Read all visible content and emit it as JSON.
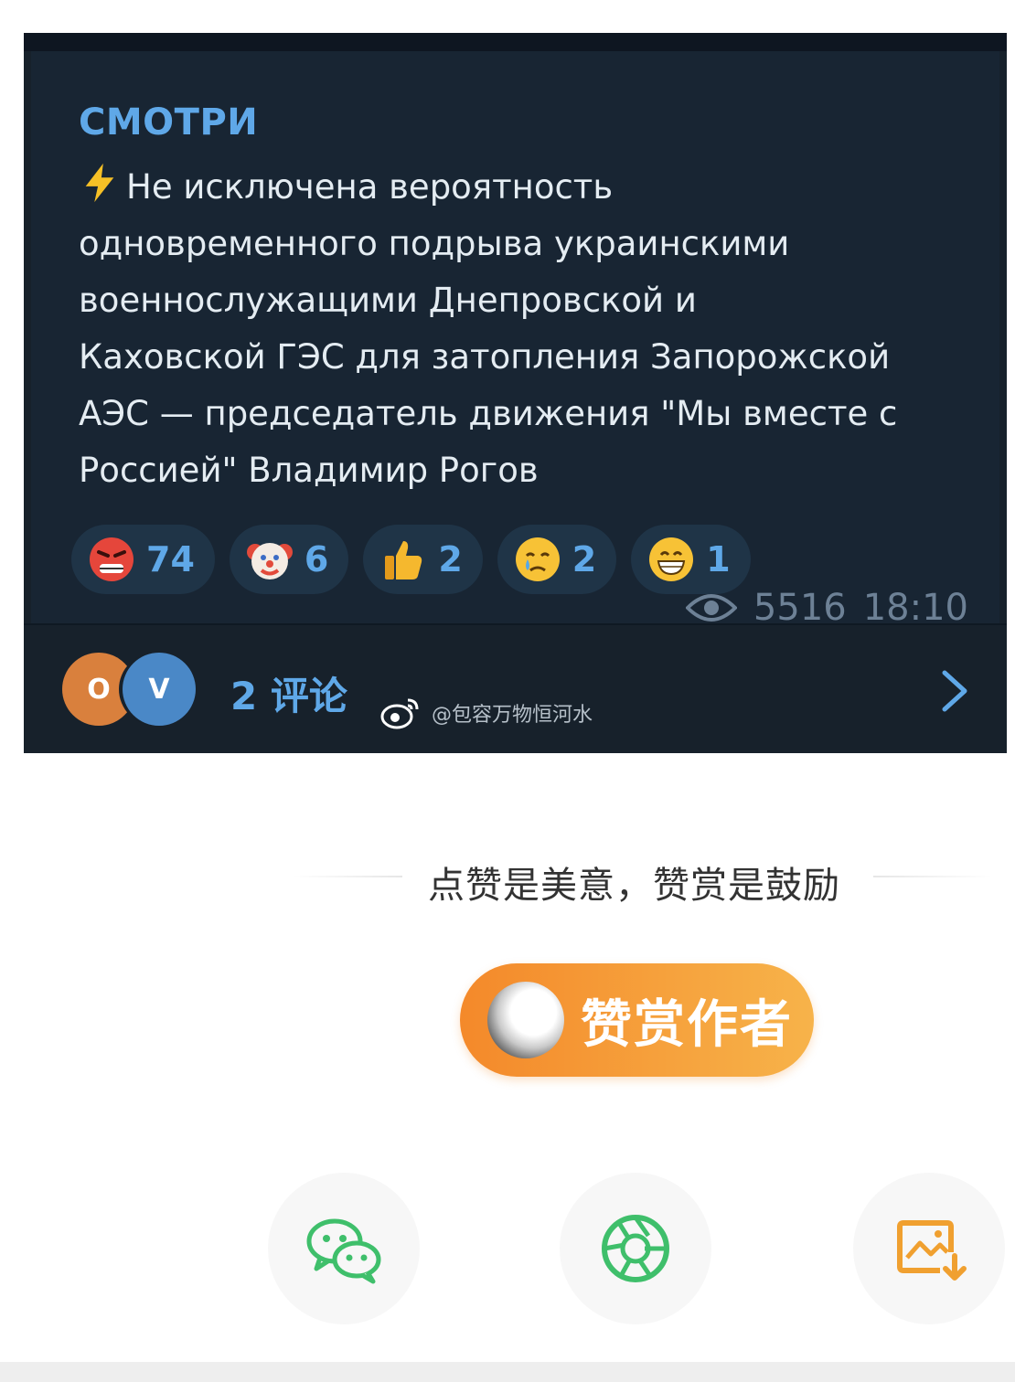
{
  "post": {
    "channel_name": "СМОТРИ",
    "text": "Не исключена вероятность\nодновременного подрыва украинскими\nвоеннослужащими Днепровской и\nКаховской ГЭС для затопления Запорожской\nАЭС — председатель движения \"Мы вместе с\nРоссией\" Владимир Рогов",
    "reactions": [
      {
        "icon": "angry-face-icon",
        "count": "74"
      },
      {
        "icon": "clown-face-icon",
        "count": "6"
      },
      {
        "icon": "thumbs-up-icon",
        "count": "2"
      },
      {
        "icon": "crying-face-icon",
        "count": "2"
      },
      {
        "icon": "grinning-face-icon",
        "count": "1"
      }
    ],
    "views": "5516",
    "time": "18:10",
    "comments": {
      "avatars": [
        "O",
        "V"
      ],
      "label": "2 评论"
    },
    "watermark": "@包容万物恒河水"
  },
  "praise": {
    "text": "点赞是美意，赞赏是鼓励",
    "reward_button": "赞赏作者"
  },
  "share": {
    "items": [
      "wechat-icon",
      "moments-icon",
      "save-image-icon"
    ]
  },
  "colors": {
    "card_bg": "#17212b",
    "accent_blue": "#5fa8e8",
    "reward_orange": "#f4892a",
    "share_green": "#3fbf6b",
    "save_orange": "#f0a030"
  }
}
